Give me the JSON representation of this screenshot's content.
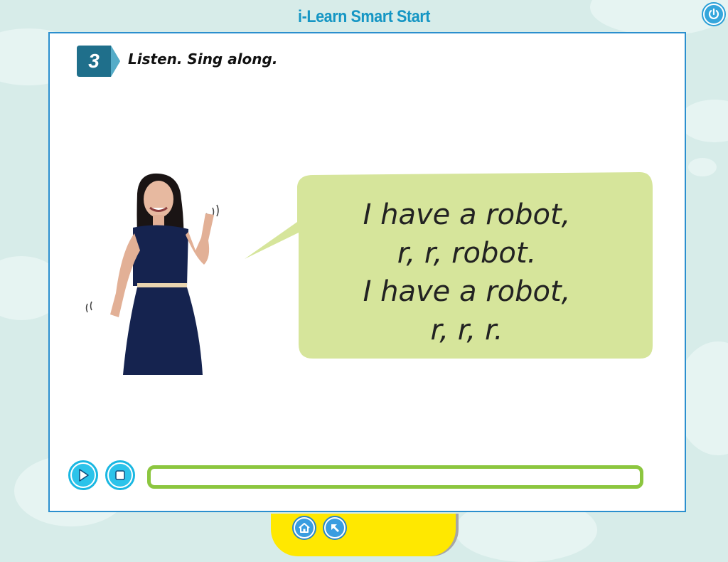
{
  "app": {
    "title": "i-Learn Smart Start"
  },
  "activity": {
    "number": "3",
    "instruction": "Listen. Sing along."
  },
  "song": {
    "lines": [
      "I have a robot,",
      "r, r, robot.",
      "I have a robot,",
      "r, r, r."
    ]
  },
  "player": {
    "progress": 0,
    "controls": [
      "play-icon",
      "stop-icon"
    ]
  },
  "nav": {
    "icons": [
      "home-icon",
      "back-arrow-icon"
    ]
  },
  "header": {
    "icons": [
      "power-icon"
    ]
  },
  "colors": {
    "title": "#1596c4",
    "frame": "#2b8fce",
    "bubble": "#d6e59b",
    "progress": "#8cc63f",
    "badge": "#1f6f8b",
    "bottom_tab": "#ffe800"
  }
}
